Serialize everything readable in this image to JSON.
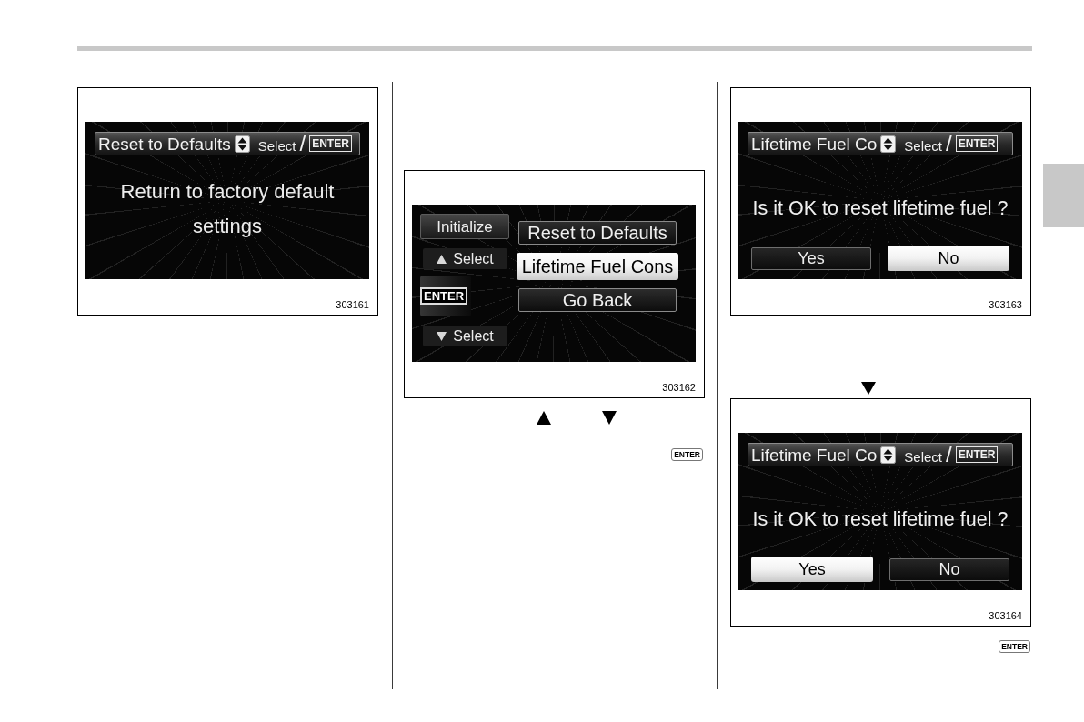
{
  "left_column": {
    "figure": {
      "kind": "message",
      "header": {
        "title": "Reset to Defaults",
        "hint": "Select",
        "separator": "/",
        "key": "ENTER"
      },
      "message": "Return to factory default settings",
      "number": "303161"
    }
  },
  "middle_column": {
    "figure": {
      "kind": "menu",
      "side_buttons": [
        {
          "kind": "title",
          "label": "Initialize"
        },
        {
          "kind": "up",
          "label": "Select"
        },
        {
          "kind": "key",
          "label": "ENTER"
        },
        {
          "kind": "down",
          "label": "Select"
        }
      ],
      "items": [
        {
          "label": "Reset to Defaults",
          "selected": false
        },
        {
          "label": "Lifetime Fuel Cons",
          "selected": true
        },
        {
          "label": "Go Back",
          "selected": false
        }
      ],
      "number": "303162"
    },
    "inline_key": "ENTER"
  },
  "right_column": {
    "figures": [
      {
        "kind": "confirm",
        "header": {
          "title": "Lifetime Fuel Co",
          "hint": "Select",
          "separator": "/",
          "key": "ENTER"
        },
        "question": "Is it OK to reset lifetime fuel ?",
        "buttons": [
          {
            "label": "Yes",
            "selected": false
          },
          {
            "label": "No",
            "selected": true
          }
        ],
        "number": "303163"
      },
      {
        "kind": "confirm",
        "header": {
          "title": "Lifetime Fuel Co",
          "hint": "Select",
          "separator": "/",
          "key": "ENTER"
        },
        "question": "Is it OK to reset lifetime fuel ?",
        "buttons": [
          {
            "label": "Yes",
            "selected": true
          },
          {
            "label": "No",
            "selected": false
          }
        ],
        "number": "303164"
      }
    ],
    "inline_key": "ENTER"
  }
}
